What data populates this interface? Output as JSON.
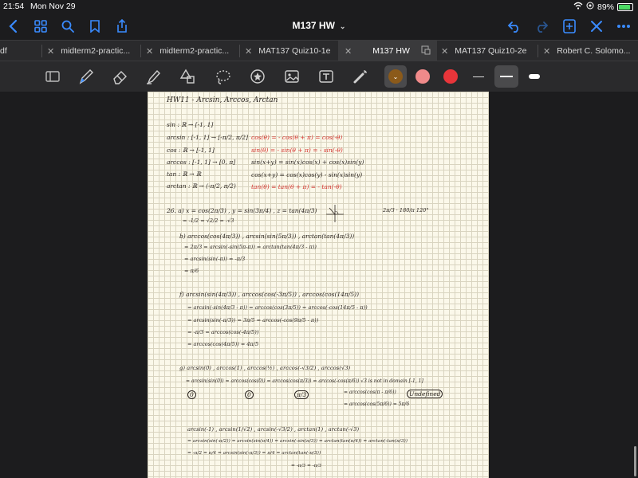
{
  "status_bar": {
    "time": "21:54",
    "date": "Mon Nov 29",
    "battery": "89%",
    "battery_level": 0.89
  },
  "nav": {
    "title": "M137 HW"
  },
  "tabs": [
    {
      "label": "df",
      "active": false
    },
    {
      "label": "midterm2-practic...",
      "active": false
    },
    {
      "label": "midterm2-practic...",
      "active": false
    },
    {
      "label": "MAT137 Quiz10-1e",
      "active": false
    },
    {
      "label": "M137 HW",
      "active": true
    },
    {
      "label": "MAT137 Quiz10-2e",
      "active": false
    },
    {
      "label": "Robert C. Solomo...",
      "active": false
    }
  ],
  "toolbar": {
    "colors": [
      "#8b5a1a",
      "#f08a8a",
      "#e8353a"
    ],
    "tools": [
      "page-icon",
      "pen-icon",
      "eraser-icon",
      "highlighter-icon",
      "shapes-icon",
      "lasso-icon",
      "sticker-icon",
      "image-icon",
      "text-icon",
      "laser-icon"
    ]
  },
  "notes": {
    "title": "HW11 - Arcsin, Arccos, Arctan",
    "defs": [
      "sin : ℝ → [-1, 1]",
      "arcsin : [-1, 1] → [-π/2, π/2]",
      "cos : ℝ → [-1, 1]",
      "arccos : [-1, 1] → [0, π]",
      "tan : ℝ → ℝ",
      "arctan : ℝ → (-π/2, π/2)"
    ],
    "identities": [
      "cos(θ) = - cos(θ + π) = cos(-θ)",
      "sin(θ) = - sin(θ + π) = - sin(-θ)",
      "sin(x+y) = sin(x)cos(x) + cos(x)sin(y)",
      "cos(x+y) = cos(x)cos(y) - sin(x)sin(y)",
      "tan(θ) = tan(θ + π) = - tan(-θ)"
    ],
    "p26a": "26. a)  x = cos(2π/3) ,   y = sin(3π/4) ,   z = tan(4π/3)",
    "p26a_vals": "= -1/2                      = √2/2                = -√3",
    "p26a_side": "2π/3 · 180/π   120°",
    "p26b_1": "b)  arccos(cos(4π/3)) ,   arcsin(sin(5π/3))   ,   arctan(tan(4π/3))",
    "p26b_2": "= 2π/3              = arcsin(-sin(5π-π))       = arctan(tan(4π/3 - π))",
    "p26b_3": "                        = arcsin(sin(-π))          = -π/3",
    "p26b_4": "                        = π/6",
    "p26f_1": "f)  arcsin(sin(4π/3))     ,     arccos(cos(-3π/5))    ,     arccos(cos(14π/5))",
    "p26f_2": "= arcsin(-sin(4π/3 - π))      = arccos(cos(3π/5))          = arccos(-cos(14π/5 - π))",
    "p26f_3": "= arcsin(sin(-π/3))            = 3π/5                          = arccos(-cos(9π/5 - π))",
    "p26f_4": "= -π/3                                                              = arccos(cos(-4π/5))",
    "p26f_5": "                                                                        = arccos(cos(4π/5)) = 4π/5",
    "p26g_1": "g)  arcsin(0)     ,     arccos(1)     ,     arccos(½)     ,     arccos(-√3/2)     ,     arccos(√3)",
    "p26g_2": "= arcsin(sin(0))      = arccos(cos(0))     = arccos(cos(π/3))    = arccos(-cos(π/6))      √3 is not in domain [-1, 1]",
    "p26g_3": "= arccos(cos(π - π/6))",
    "p26g_4": "= arccos(cos(5π/6)) = 5π/6",
    "p26g_ans": [
      "0",
      "0",
      "π/3",
      "Undefined"
    ],
    "p26h_1": "arcsin(-1)     ,     arcsin(1/√2)     ,     arcsin(-√3/2)     ,     arctan(1)     ,     arctan(-√3)",
    "p26h_2": "= arcsin(sin(-π/2))   = arcsin(sin(π/4))   = arcsin(-sin(π/3))   = arctan(tan(π/4))   = arctan(-tan(π/3))",
    "p26h_3": "= -π/2                    = π/4                  = arcsin(sin(-π/3))    = π/4                      = arctan(tan(-π/3))",
    "p26h_4": "= -π/3                                                = -π/3"
  }
}
